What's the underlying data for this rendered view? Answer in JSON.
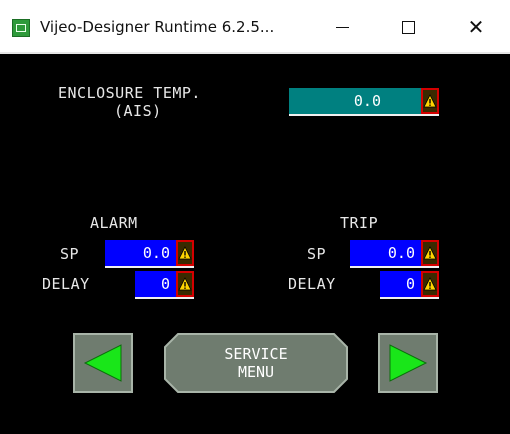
{
  "window": {
    "title": "Vijeo-Designer Runtime 6.2.5...",
    "minimize_label": "minimize",
    "maximize_label": "maximize",
    "close_label": "close"
  },
  "enclosure": {
    "label_line1": "ENCLOSURE TEMP.",
    "label_line2": "(AIS)",
    "value": "0.0",
    "field_color": "#008080"
  },
  "alarm": {
    "heading": "ALARM",
    "sp_label": "SP",
    "sp_value": "0.0",
    "delay_label": "DELAY",
    "delay_value": "0"
  },
  "trip": {
    "heading": "TRIP",
    "sp_label": "SP",
    "sp_value": "0.0",
    "delay_label": "DELAY",
    "delay_value": "0"
  },
  "nav": {
    "prev_icon": "left-arrow-icon",
    "next_icon": "right-arrow-icon",
    "service_line1": "SERVICE",
    "service_line2": "MENU"
  },
  "colors": {
    "setpoint_field": "#0000ff",
    "arrow_green": "#19e619",
    "warning_yellow": "#ffd400",
    "warning_border": "#d40000",
    "button_gray": "#6f7c6f"
  }
}
